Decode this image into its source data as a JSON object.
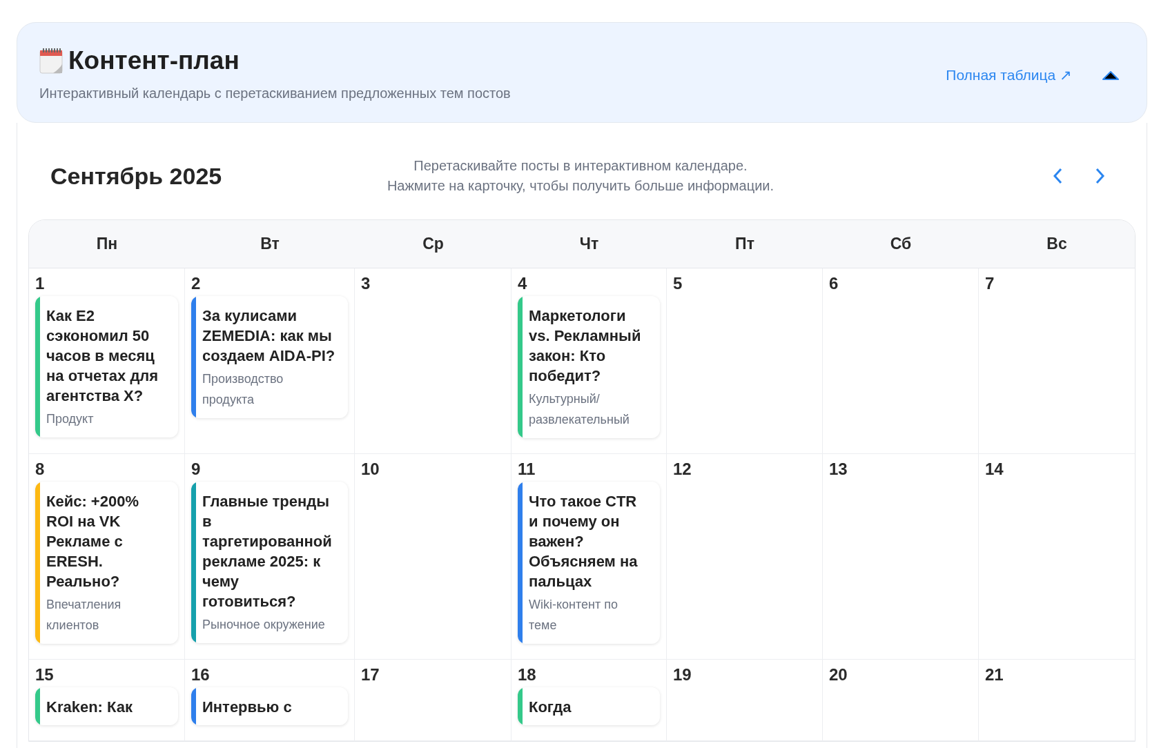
{
  "header": {
    "title": "Контент-план",
    "subtitle": "Интерактивный календарь с перетаскиванием предложенных тем постов",
    "link": "Полная таблица ↗",
    "expanded": true
  },
  "calendar": {
    "month": "Сентябрь 2025",
    "hint_lines": [
      "Перетаскивайте посты в интерактивном календаре.",
      "Нажмите на карточку, чтобы получить больше информации."
    ],
    "weekdays": [
      "Пн",
      "Вт",
      "Ср",
      "Чт",
      "Пт",
      "Сб",
      "Вс"
    ],
    "weeks": [
      {
        "days": [
          {
            "number": "1",
            "posts": [
              {
                "title": "Как E2 сэкономил 50 часов в месяц на отчетах для агентства X?",
                "category": "Продукт",
                "color": "#34c98a"
              }
            ]
          },
          {
            "number": "2",
            "posts": [
              {
                "title": "За кулисами ZEMEDIA: как мы создаем AIDA-PI?",
                "category": "Производство продукта",
                "color": "#2f7fec"
              }
            ]
          },
          {
            "number": "3"
          },
          {
            "number": "4",
            "posts": [
              {
                "title": "Маркетологи vs. Рекламный закон: Кто победит?",
                "category": "Культурный/развлекательный",
                "color": "#34c98a"
              }
            ]
          },
          {
            "number": "5"
          },
          {
            "number": "6"
          },
          {
            "number": "7"
          }
        ]
      },
      {
        "days": [
          {
            "number": "8",
            "posts": [
              {
                "title": "Кейс: +200% ROI на VK Рекламе с ERESH. Реально?",
                "category": "Впечатления клиентов",
                "color": "#fdb913"
              }
            ]
          },
          {
            "number": "9",
            "posts": [
              {
                "title": "Главные тренды в таргетированной рекламе 2025: к чему готовиться?",
                "category": "Рыночное окружение",
                "color": "#16a0ac"
              }
            ]
          },
          {
            "number": "10"
          },
          {
            "number": "11",
            "posts": [
              {
                "title": "Что такое CTR и почему он важен? Объясняем на пальцах",
                "category": "Wiki-контент по теме",
                "color": "#2f7fec"
              }
            ]
          },
          {
            "number": "12"
          },
          {
            "number": "13"
          },
          {
            "number": "14"
          }
        ]
      },
      {
        "days": [
          {
            "number": "15",
            "posts": [
              {
                "title": "Kraken: Как",
                "color": "#34c98a"
              }
            ]
          },
          {
            "number": "16",
            "posts": [
              {
                "title": "Интервью с",
                "color": "#2f7fec"
              }
            ]
          },
          {
            "number": "17"
          },
          {
            "number": "18",
            "posts": [
              {
                "title": "Когда",
                "color": "#34c98a"
              }
            ]
          },
          {
            "number": "19"
          },
          {
            "number": "20"
          },
          {
            "number": "21"
          }
        ]
      }
    ]
  }
}
